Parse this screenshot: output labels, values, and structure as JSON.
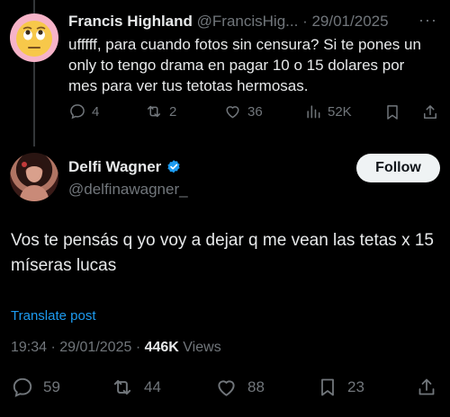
{
  "reply": {
    "name": "Francis Highland",
    "handle": "@FrancisHig...",
    "separator": "·",
    "date": "29/01/2025",
    "more": "···",
    "text": "ufffff, para cuando fotos sin censura? Si te pones un only to tengo drama en pagar 10 o 15 dolares por mes para ver tus tetotas hermosas.",
    "replies": "4",
    "reposts": "2",
    "likes": "36",
    "views": "52K"
  },
  "post": {
    "name": "Delfi Wagner",
    "handle": "@delfinawagner_",
    "follow_label": "Follow",
    "text": "Vos te pensás q yo voy a dejar q me vean las tetas x 15 míseras lucas",
    "translate_label": "Translate post",
    "time": "19:34",
    "date": "29/01/2025",
    "separator": "·",
    "views_count": "446K",
    "views_label": "Views",
    "replies": "59",
    "reposts": "44",
    "likes": "88",
    "bookmarks": "23"
  },
  "colors": {
    "accent": "#1d9bf0",
    "muted": "#71767b",
    "text": "#e7e9ea",
    "background": "#000000"
  }
}
